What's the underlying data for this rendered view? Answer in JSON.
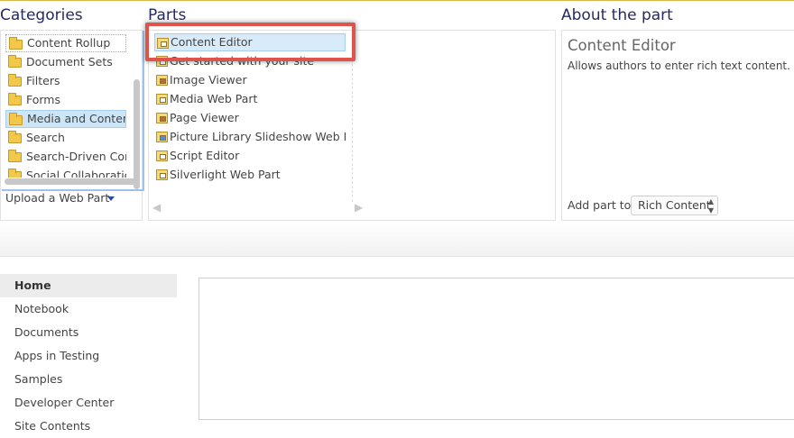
{
  "categories": {
    "heading": "Categories",
    "items": [
      {
        "label": "Content Rollup"
      },
      {
        "label": "Document Sets"
      },
      {
        "label": "Filters"
      },
      {
        "label": "Forms"
      },
      {
        "label": "Media and Content",
        "selected": true
      },
      {
        "label": "Search"
      },
      {
        "label": "Search-Driven Content"
      },
      {
        "label": "Social Collaboration"
      }
    ],
    "upload_label": "Upload a Web Part"
  },
  "parts": {
    "heading": "Parts",
    "items": [
      {
        "label": "Content Editor",
        "selected": true,
        "icon": "content-editor-icon"
      },
      {
        "label": "Get started with your site",
        "icon": "web-part-icon"
      },
      {
        "label": "Image Viewer",
        "icon": "image-viewer-icon"
      },
      {
        "label": "Media Web Part",
        "icon": "web-part-icon"
      },
      {
        "label": "Page Viewer",
        "icon": "page-viewer-icon"
      },
      {
        "label": "Picture Library Slideshow Web Part",
        "icon": "picture-library-icon"
      },
      {
        "label": "Script Editor",
        "icon": "script-editor-icon"
      },
      {
        "label": "Silverlight Web Part",
        "icon": "silverlight-icon"
      }
    ]
  },
  "about": {
    "heading": "About the part",
    "part_title": "Content Editor",
    "description": "Allows authors to enter rich text content.",
    "add_part_label": "Add part to:",
    "add_part_value": "Rich Content"
  },
  "quick_launch": {
    "items": [
      {
        "label": "Home",
        "selected": true
      },
      {
        "label": "Notebook"
      },
      {
        "label": "Documents"
      },
      {
        "label": "Apps in Testing"
      },
      {
        "label": "Samples"
      },
      {
        "label": "Developer Center"
      },
      {
        "label": "Site Contents"
      }
    ]
  },
  "colors": {
    "heading": "#252a60",
    "selection": "#cde6f7",
    "highlight_border": "#e0534a",
    "category_list_border": "#9ec1ee"
  }
}
